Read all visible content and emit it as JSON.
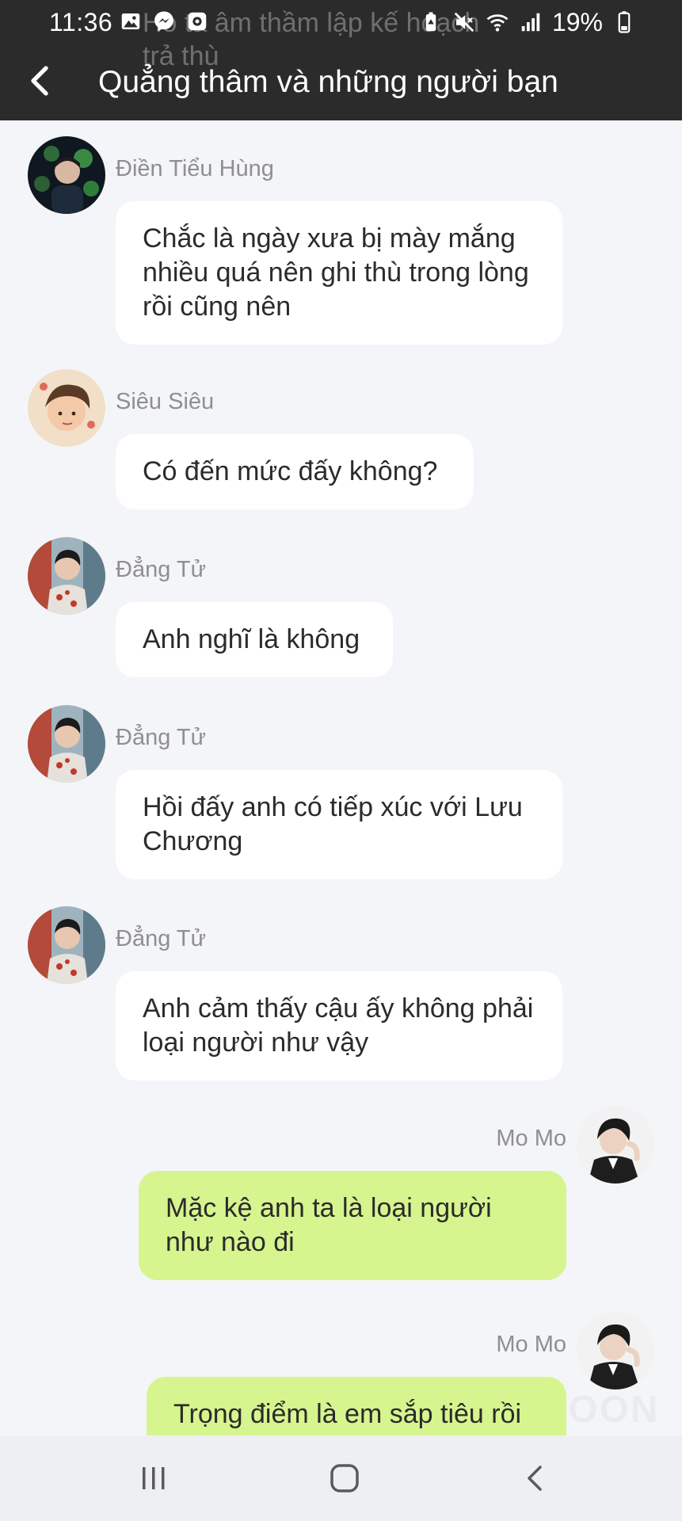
{
  "status_bar": {
    "time": "11:36",
    "battery": "19%",
    "left_icons": [
      "image-icon",
      "messenger-icon",
      "camera-icon"
    ],
    "right_icons": [
      "battery-saver-icon",
      "mute-icon",
      "wifi-icon",
      "signal-icon",
      "battery-icon"
    ],
    "ghost_text": "Ho ta âm thầm lập kế hoạch\ntrả thù"
  },
  "header": {
    "title": "Quẳng thâm và những người bạn",
    "back_icon": "chevron-left-icon",
    "background": "#2b2b2b"
  },
  "messages": [
    {
      "side": "left",
      "sender": "Điền Tiểu Hùng",
      "text": "Chắc là ngày xưa bị mày mắng nhiều quá nên ghi thù trong lòng rồi cũng nên",
      "avatar": "avatar-dien-tieu-hung"
    },
    {
      "side": "left",
      "sender": "Siêu Siêu",
      "text": "Có đến mức đấy không?",
      "avatar": "avatar-sieu-sieu"
    },
    {
      "side": "left",
      "sender": "Đẳng Tử",
      "text": "Anh nghĩ là không",
      "avatar": "avatar-dang-tu"
    },
    {
      "side": "left",
      "sender": "Đẳng Tử",
      "text": "Hồi đấy anh có tiếp xúc với Lưu Chương",
      "avatar": "avatar-dang-tu"
    },
    {
      "side": "left",
      "sender": "Đẳng Tử",
      "text": "Anh cảm thấy cậu ấy không phải loại người như vậy",
      "avatar": "avatar-dang-tu"
    },
    {
      "side": "right",
      "sender": "Mo Mo",
      "text": "Mặc kệ anh ta là loại người như nào đi",
      "avatar": "avatar-mo-mo"
    },
    {
      "side": "right",
      "sender": "Mo Mo",
      "text": "Trọng điểm là em sắp tiêu rồi",
      "avatar": "avatar-mo-mo"
    }
  ],
  "watermark": "NOVELTOON",
  "colors": {
    "chat_background": "#f4f5f8",
    "incoming_bubble": "#ffffff",
    "outgoing_bubble": "#d6f58e",
    "sender_name": "#8e8e93"
  },
  "nav_bar": {
    "icons": [
      "recent-apps-icon",
      "home-icon",
      "back-icon"
    ]
  }
}
